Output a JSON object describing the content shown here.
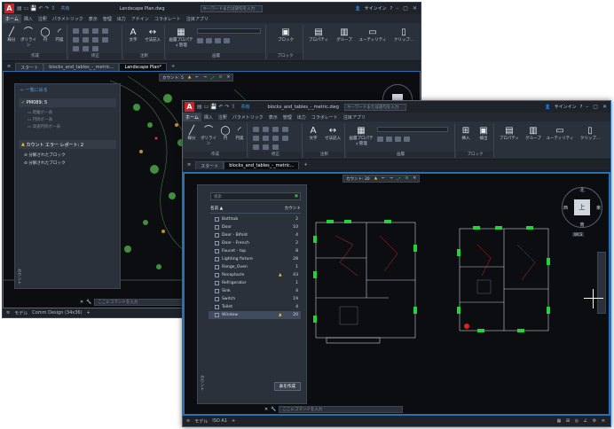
{
  "back_window": {
    "title": "Landscape Plan.dwg",
    "share": "共有",
    "search_placeholder": "キーワードまたは語句を入力",
    "signin": "サインイン",
    "ribbon_tabs": [
      "ホーム",
      "挿入",
      "注釈",
      "パラメトリック",
      "表示",
      "管理",
      "出力",
      "アドイン",
      "コラボレート",
      "注目アプリ"
    ],
    "ribbon_tools": [
      "線分",
      "ポリライン",
      "円",
      "円弧",
      "文字",
      "寸法記入",
      "画層プロパティ管理",
      "ブロック",
      "プロパティ",
      "グループ",
      "ユーティリティ",
      "クリップ..."
    ],
    "ribbon_groups": [
      "作成",
      "修正",
      "注釈",
      "画層",
      "ブロック"
    ],
    "file_tabs": [
      "スタート",
      "blocks_and_tables_-_metric...",
      "Landscape Plan*"
    ],
    "count_label": "カウント: 5",
    "panel": {
      "back": "一覧に戻る",
      "total": "PM089: 5",
      "items": [
        "距離ボー表",
        "円筒ボー表",
        "高速円筒ボー表"
      ],
      "error_title": "カウント エラー レポート: 2",
      "errors": [
        "分解されたブロック",
        "分解されたブロック"
      ],
      "vertical": "カウント"
    },
    "command_placeholder": "ここにコマンドを入力",
    "status_tabs": [
      "モデル",
      "Comm Design (34x36)"
    ]
  },
  "front_window": {
    "title": "blocks_and_tables_-_metric.dwg",
    "share": "共有",
    "search_placeholder": "キーワードまたは語句を入力",
    "signin": "サインイン",
    "ribbon_tabs": [
      "ホーム",
      "挿入",
      "注釈",
      "パラメトリック",
      "表示",
      "管理",
      "出力",
      "コラボレート",
      "注目アプリ"
    ],
    "ribbon_tools": [
      "線分",
      "ポリライン",
      "円",
      "円弧",
      "文字",
      "寸法記入",
      "画層プロパティ管理",
      "挿入",
      "検出",
      "プロパティ",
      "グループ",
      "ユーティリティ",
      "クリップ..."
    ],
    "ribbon_groups": [
      "作成",
      "修正",
      "注釈",
      "画層",
      "ブロック"
    ],
    "file_tabs": [
      "スタート",
      "blocks_and_tables_-_metric..."
    ],
    "count_label": "カウント: 20",
    "panel": {
      "search_placeholder": "検索",
      "col_name": "名前",
      "col_count": "カウント",
      "rows": [
        {
          "name": "Bathtub",
          "count": "2",
          "warn": false
        },
        {
          "name": "Door",
          "count": "10",
          "warn": false
        },
        {
          "name": "Door - Bifold",
          "count": "4",
          "warn": false
        },
        {
          "name": "Door - French",
          "count": "2",
          "warn": false
        },
        {
          "name": "Faucet - top",
          "count": "8",
          "warn": false
        },
        {
          "name": "Lighting fixture",
          "count": "28",
          "warn": false
        },
        {
          "name": "Range_Oven",
          "count": "1",
          "warn": false
        },
        {
          "name": "Receptacle",
          "count": "43",
          "warn": true
        },
        {
          "name": "Refrigerator",
          "count": "1",
          "warn": false
        },
        {
          "name": "Sink",
          "count": "4",
          "warn": false
        },
        {
          "name": "Switch",
          "count": "19",
          "warn": false
        },
        {
          "name": "Toilet",
          "count": "4",
          "warn": false
        },
        {
          "name": "Window",
          "count": "20",
          "warn": true
        }
      ],
      "create_button": "表を作成",
      "vertical": "カウント"
    },
    "viewcube": {
      "top": "北",
      "left": "西",
      "right": "東",
      "bottom": "南",
      "face": "上",
      "wcs": "WCS"
    },
    "command_placeholder": "ここにコマンドを入力",
    "status_tabs": [
      "モデル",
      "ISO A1"
    ]
  },
  "colors": {
    "accent": "#2a6fb0",
    "warning": "#f2c418",
    "success": "#3fbf4d",
    "brand": "#c1272d"
  }
}
